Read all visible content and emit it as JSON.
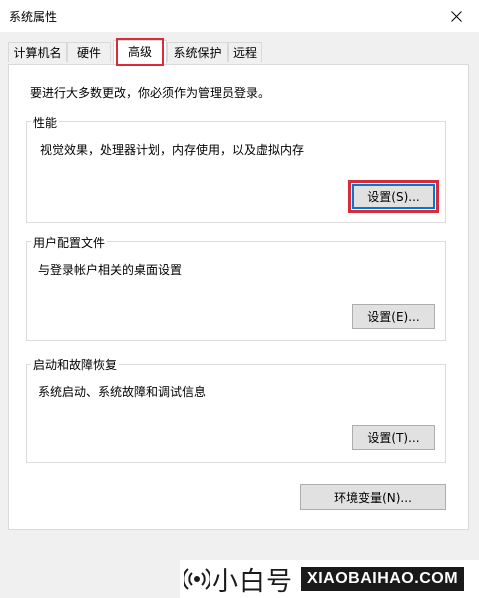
{
  "window": {
    "title": "系统属性",
    "close_icon": "close-icon"
  },
  "tabs": [
    {
      "label": "计算机名",
      "active": false
    },
    {
      "label": "硬件",
      "active": false
    },
    {
      "label": "高级",
      "active": true
    },
    {
      "label": "系统保护",
      "active": false
    },
    {
      "label": "远程",
      "active": false
    }
  ],
  "admin_note": "要进行大多数更改，你必须作为管理员登录。",
  "performance": {
    "label": "性能",
    "description": "视觉效果，处理器计划，内存使用，以及虚拟内存",
    "button": "设置(S)..."
  },
  "user_profiles": {
    "label": "用户配置文件",
    "description": "与登录帐户相关的桌面设置",
    "button": "设置(E)..."
  },
  "startup_recovery": {
    "label": "启动和故障恢复",
    "description": "系统启动、系统故障和调试信息",
    "button": "设置(T)..."
  },
  "env_button": "环境变量(N)...",
  "watermark": {
    "cn": "小白号",
    "en": "XIAOBAIHAO.COM",
    "icon": "signal-icon"
  },
  "colors": {
    "highlight": "#d92b3a",
    "focus": "#0078d7"
  }
}
